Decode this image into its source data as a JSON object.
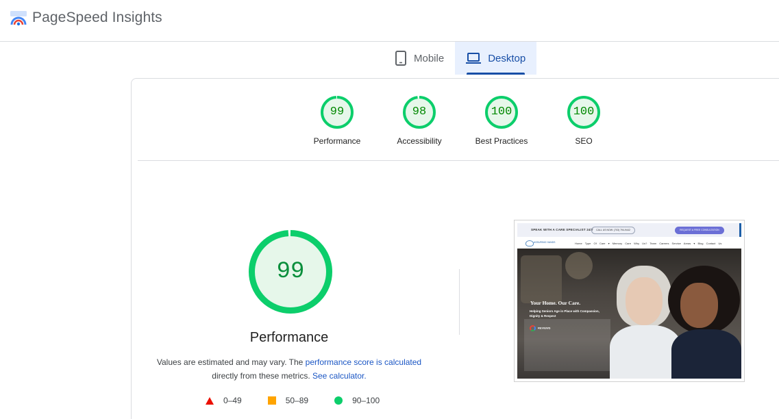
{
  "header": {
    "app_title": "PageSpeed Insights",
    "logo_icon": "pagespeed-logo-icon"
  },
  "tabs": [
    {
      "label": "Mobile",
      "icon": "mobile-phone-icon",
      "active": false
    },
    {
      "label": "Desktop",
      "icon": "laptop-icon",
      "active": true
    }
  ],
  "summary": [
    {
      "score": "99",
      "label": "Performance"
    },
    {
      "score": "98",
      "label": "Accessibility"
    },
    {
      "score": "100",
      "label": "Best Practices"
    },
    {
      "score": "100",
      "label": "SEO"
    }
  ],
  "performance": {
    "score": "99",
    "title": "Performance",
    "desc_prefix": "Values are estimated and may vary. The ",
    "desc_link1": "performance score is calculated",
    "desc_middle": "directly from these metrics.",
    "desc_link2": "See calculator."
  },
  "legend": [
    {
      "range": "0–49",
      "shape": "triangle",
      "color": "#eb0f00"
    },
    {
      "range": "50–89",
      "shape": "square",
      "color": "#ffa400"
    },
    {
      "range": "90–100",
      "shape": "circle",
      "color": "#0cce6b"
    }
  ],
  "screenshot": {
    "topbar": "SPEAK WITH A CARE SPECIALIST 24/7",
    "call": "CALL US NOW: (703) 794-9442",
    "consult": "REQUEST A FREE CONSULTATION",
    "brand": "ASSURING HANDS",
    "menu": "Home  Type Of Care ▾  Memory Care  Why Us?  Team  Careers  Service Areas ▾  Blog  Contact Us",
    "headline": "Your Home. Our Care.",
    "subheadline": "Helping Seniors Age in Place with Compassion, Dignity & Respect",
    "reviews": "REVIEWS"
  },
  "colors": {
    "pass_green": "#0cce6b",
    "pass_text": "#008800",
    "pass_fill": "#e6f7ea",
    "active_tab_bg": "#e8f0fe",
    "active_tab_text": "#174ea6",
    "link": "#1a56c4"
  }
}
